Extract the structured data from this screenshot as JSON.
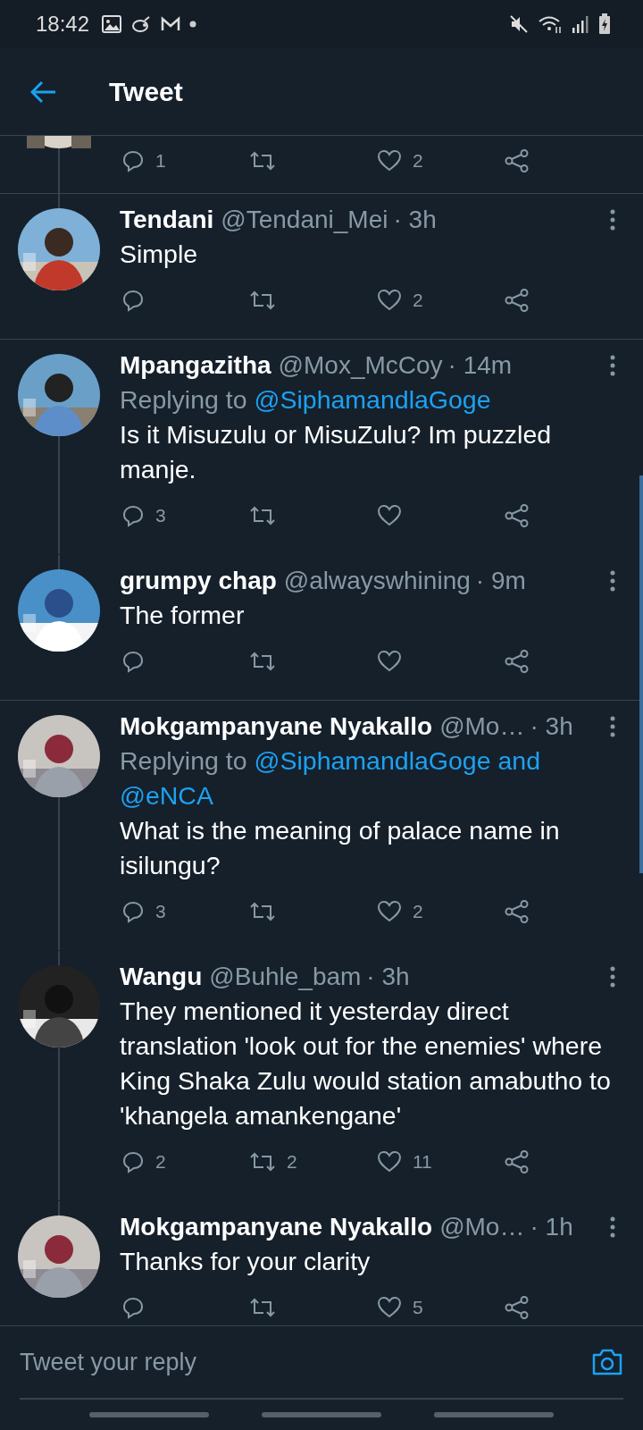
{
  "status_bar": {
    "time": "18:42"
  },
  "header": {
    "title": "Tweet"
  },
  "previous_actions": {
    "replies": "1",
    "likes": "2"
  },
  "tweets": [
    {
      "name": "Tendani",
      "handle": "@Tendani_Mei",
      "time": "· 3h",
      "text": "Simple",
      "actions": {
        "likes": "2"
      },
      "thread_above": true,
      "thread_below": false,
      "divider_after": true
    },
    {
      "name": "Mpangazitha",
      "handle": "@Mox_McCoy",
      "time": "· 14m",
      "replying_to": {
        "prefix": "Replying to",
        "links": [
          "@SiphamandlaGoge"
        ]
      },
      "text": "Is it Misuzulu or MisuZulu? Im puzzled manje.",
      "actions": {
        "replies": "3"
      },
      "thread_above": false,
      "thread_below": true,
      "divider_after": false
    },
    {
      "name": "grumpy chap",
      "handle": "@alwayswhining",
      "time": "· 9m",
      "text": "The former",
      "thread_above": true,
      "thread_below": false,
      "divider_after": true
    },
    {
      "name": "Mokgampanyane Nyakallo",
      "handle": "@Mo…",
      "time": "· 3h",
      "replying_to": {
        "prefix": "Replying to",
        "links": [
          "@SiphamandlaGoge and",
          "@eNCA"
        ]
      },
      "text": "What is the meaning of palace name in isilungu?",
      "actions": {
        "replies": "3",
        "likes": "2"
      },
      "thread_above": false,
      "thread_below": true,
      "divider_after": false
    },
    {
      "name": "Wangu",
      "handle": "@Buhle_bam",
      "time": "· 3h",
      "text": "They mentioned it yesterday direct translation 'look out for the enemies' where King Shaka Zulu would station amabutho to 'khangela amankengane'",
      "actions": {
        "replies": "2",
        "retweets": "2",
        "likes": "11"
      },
      "thread_above": true,
      "thread_below": true,
      "divider_after": false
    },
    {
      "name": "Mokgampanyane Nyakallo",
      "handle": "@Mo…",
      "time": "· 1h",
      "text": "Thanks for your clarity",
      "actions": {
        "likes": "5"
      },
      "thread_above": true
    }
  ],
  "reply_bar": {
    "placeholder": "Tweet your reply"
  }
}
